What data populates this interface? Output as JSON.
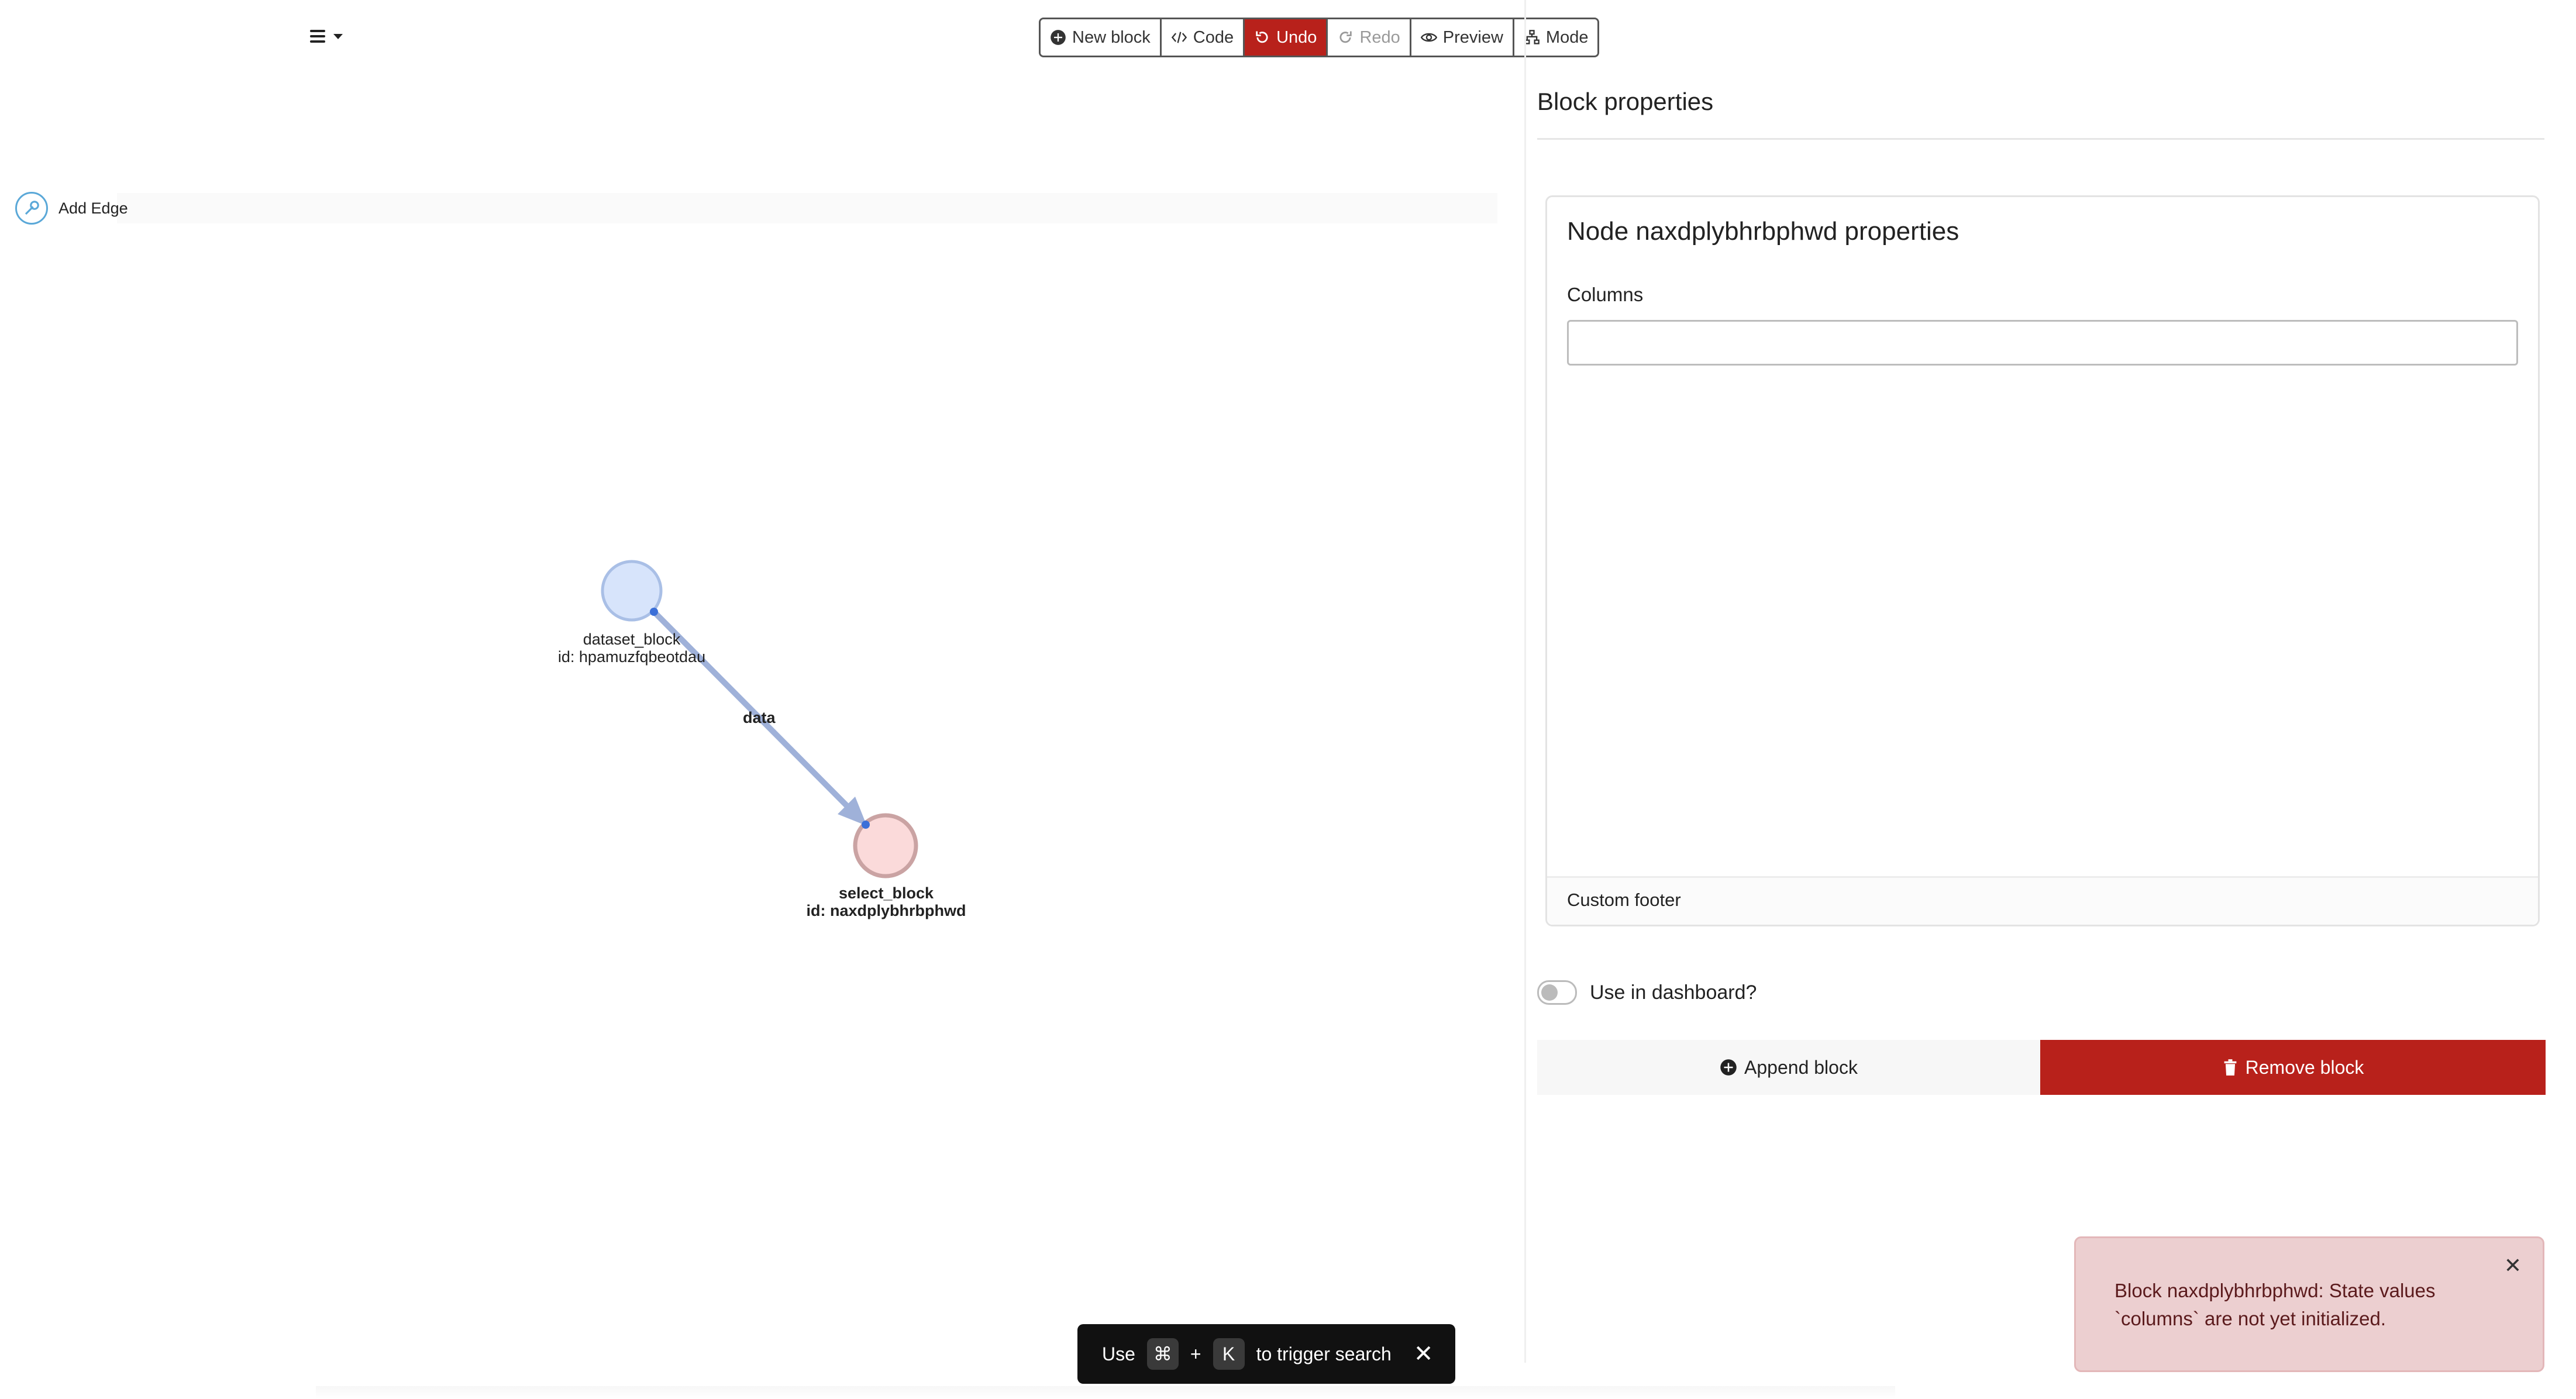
{
  "toolbar": {
    "new_block": "New block",
    "code": "Code",
    "undo": "Undo",
    "redo": "Redo",
    "preview": "Preview",
    "mode": "Mode",
    "danger_color": "#b8211b"
  },
  "canvas": {
    "add_edge": "Add Edge",
    "nodes": [
      {
        "name": "dataset_block",
        "id": "id: hpamuzfqbeotdau",
        "fill": "#d7e4fb",
        "stroke": "#a9bfe6"
      },
      {
        "name": "select_block",
        "id": "id: naxdplybhrbphwd",
        "fill": "#fbdada",
        "stroke": "#caa3a3"
      }
    ],
    "edge_label": "data",
    "edge_color": "#9fb1d9"
  },
  "panel": {
    "title": "Block properties",
    "card": {
      "title": "Node naxdplybhrbphwd properties",
      "field_label": "Columns",
      "field_value": "",
      "footer": "Custom footer"
    },
    "dashboard_toggle": "Use in dashboard?",
    "append_block": "Append block",
    "remove_block": "Remove block"
  },
  "toast": {
    "message": "Block naxdplybhrbphwd: State values `columns` are not yet initialized."
  },
  "search_hint": {
    "use": "Use",
    "key1": "⌘",
    "plus": "+",
    "key2": "K",
    "rest": "to trigger search"
  }
}
